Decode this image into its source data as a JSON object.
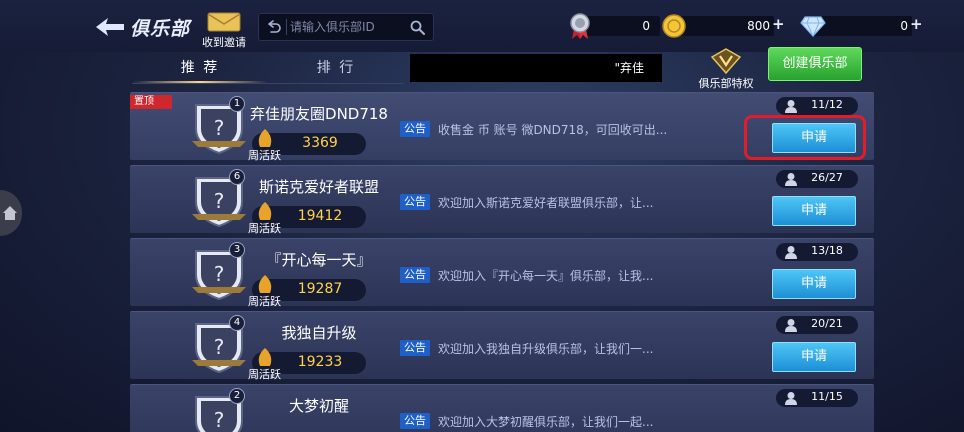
{
  "header": {
    "title": "俱乐部",
    "invite_label": "收到邀请",
    "search_placeholder": "请输入俱乐部ID"
  },
  "currencies": [
    {
      "name": "silver-medal",
      "value": "0",
      "has_plus": false
    },
    {
      "name": "gold-coin",
      "value": "800",
      "has_plus": true
    },
    {
      "name": "diamond",
      "value": "0",
      "has_plus": true
    }
  ],
  "tabs": [
    {
      "label": "推 荐",
      "active": true
    },
    {
      "label": "排 行",
      "active": false
    }
  ],
  "name_strip_text": "\"弃佳",
  "privilege_label": "俱乐部特权",
  "create_button": "创建俱乐部",
  "pin_label": "置顶",
  "notice_label": "公告",
  "activity_label": "周活跃",
  "apply_label": "申请",
  "clubs": [
    {
      "rank": "1",
      "name": "弃佳朋友圈DND718",
      "activity": "3369",
      "notice": "收售金 币 账号 微DND718，可回收可出...",
      "members": "11/12",
      "pinned": true
    },
    {
      "rank": "6",
      "name": "斯诺克爱好者联盟",
      "activity": "19412",
      "notice": "欢迎加入斯诺克爱好者联盟俱乐部，让...",
      "members": "26/27",
      "pinned": false
    },
    {
      "rank": "3",
      "name": "『开心每一天』",
      "activity": "19287",
      "notice": "欢迎加入『开心每一天』俱乐部，让我...",
      "members": "13/18",
      "pinned": false
    },
    {
      "rank": "4",
      "name": "我独自升级",
      "activity": "19233",
      "notice": "欢迎加入我独自升级俱乐部，让我们一...",
      "members": "20/21",
      "pinned": false
    },
    {
      "rank": "2",
      "name": "大梦初醒",
      "activity": "",
      "notice": "欢迎加入大梦初醒俱乐部，让我们一起...",
      "members": "11/15",
      "pinned": false
    }
  ],
  "colors": {
    "accent_gold": "#ffd34d",
    "apply_blue": "#1d8fd6",
    "create_green": "#27a22f",
    "highlight_red": "#e11d2a"
  }
}
